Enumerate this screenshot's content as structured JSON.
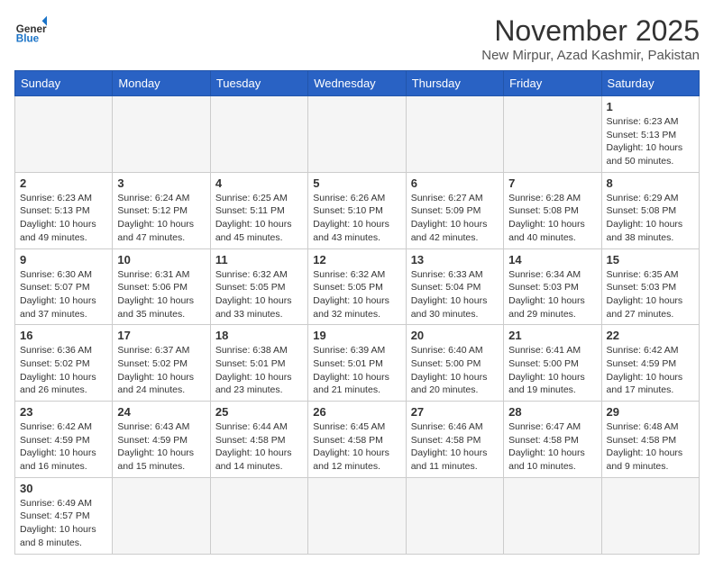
{
  "header": {
    "logo_general": "General",
    "logo_blue": "Blue",
    "title": "November 2025",
    "subtitle": "New Mirpur, Azad Kashmir, Pakistan"
  },
  "days_of_week": [
    "Sunday",
    "Monday",
    "Tuesday",
    "Wednesday",
    "Thursday",
    "Friday",
    "Saturday"
  ],
  "weeks": [
    [
      {
        "day": "",
        "info": ""
      },
      {
        "day": "",
        "info": ""
      },
      {
        "day": "",
        "info": ""
      },
      {
        "day": "",
        "info": ""
      },
      {
        "day": "",
        "info": ""
      },
      {
        "day": "",
        "info": ""
      },
      {
        "day": "1",
        "info": "Sunrise: 6:23 AM\nSunset: 5:13 PM\nDaylight: 10 hours\nand 50 minutes."
      }
    ],
    [
      {
        "day": "2",
        "info": "Sunrise: 6:23 AM\nSunset: 5:13 PM\nDaylight: 10 hours\nand 49 minutes."
      },
      {
        "day": "3",
        "info": "Sunrise: 6:24 AM\nSunset: 5:12 PM\nDaylight: 10 hours\nand 47 minutes."
      },
      {
        "day": "4",
        "info": "Sunrise: 6:25 AM\nSunset: 5:11 PM\nDaylight: 10 hours\nand 45 minutes."
      },
      {
        "day": "5",
        "info": "Sunrise: 6:26 AM\nSunset: 5:10 PM\nDaylight: 10 hours\nand 43 minutes."
      },
      {
        "day": "6",
        "info": "Sunrise: 6:27 AM\nSunset: 5:09 PM\nDaylight: 10 hours\nand 42 minutes."
      },
      {
        "day": "7",
        "info": "Sunrise: 6:28 AM\nSunset: 5:08 PM\nDaylight: 10 hours\nand 40 minutes."
      },
      {
        "day": "8",
        "info": "Sunrise: 6:29 AM\nSunset: 5:08 PM\nDaylight: 10 hours\nand 38 minutes."
      }
    ],
    [
      {
        "day": "9",
        "info": "Sunrise: 6:30 AM\nSunset: 5:07 PM\nDaylight: 10 hours\nand 37 minutes."
      },
      {
        "day": "10",
        "info": "Sunrise: 6:31 AM\nSunset: 5:06 PM\nDaylight: 10 hours\nand 35 minutes."
      },
      {
        "day": "11",
        "info": "Sunrise: 6:32 AM\nSunset: 5:05 PM\nDaylight: 10 hours\nand 33 minutes."
      },
      {
        "day": "12",
        "info": "Sunrise: 6:32 AM\nSunset: 5:05 PM\nDaylight: 10 hours\nand 32 minutes."
      },
      {
        "day": "13",
        "info": "Sunrise: 6:33 AM\nSunset: 5:04 PM\nDaylight: 10 hours\nand 30 minutes."
      },
      {
        "day": "14",
        "info": "Sunrise: 6:34 AM\nSunset: 5:03 PM\nDaylight: 10 hours\nand 29 minutes."
      },
      {
        "day": "15",
        "info": "Sunrise: 6:35 AM\nSunset: 5:03 PM\nDaylight: 10 hours\nand 27 minutes."
      }
    ],
    [
      {
        "day": "16",
        "info": "Sunrise: 6:36 AM\nSunset: 5:02 PM\nDaylight: 10 hours\nand 26 minutes."
      },
      {
        "day": "17",
        "info": "Sunrise: 6:37 AM\nSunset: 5:02 PM\nDaylight: 10 hours\nand 24 minutes."
      },
      {
        "day": "18",
        "info": "Sunrise: 6:38 AM\nSunset: 5:01 PM\nDaylight: 10 hours\nand 23 minutes."
      },
      {
        "day": "19",
        "info": "Sunrise: 6:39 AM\nSunset: 5:01 PM\nDaylight: 10 hours\nand 21 minutes."
      },
      {
        "day": "20",
        "info": "Sunrise: 6:40 AM\nSunset: 5:00 PM\nDaylight: 10 hours\nand 20 minutes."
      },
      {
        "day": "21",
        "info": "Sunrise: 6:41 AM\nSunset: 5:00 PM\nDaylight: 10 hours\nand 19 minutes."
      },
      {
        "day": "22",
        "info": "Sunrise: 6:42 AM\nSunset: 4:59 PM\nDaylight: 10 hours\nand 17 minutes."
      }
    ],
    [
      {
        "day": "23",
        "info": "Sunrise: 6:42 AM\nSunset: 4:59 PM\nDaylight: 10 hours\nand 16 minutes."
      },
      {
        "day": "24",
        "info": "Sunrise: 6:43 AM\nSunset: 4:59 PM\nDaylight: 10 hours\nand 15 minutes."
      },
      {
        "day": "25",
        "info": "Sunrise: 6:44 AM\nSunset: 4:58 PM\nDaylight: 10 hours\nand 14 minutes."
      },
      {
        "day": "26",
        "info": "Sunrise: 6:45 AM\nSunset: 4:58 PM\nDaylight: 10 hours\nand 12 minutes."
      },
      {
        "day": "27",
        "info": "Sunrise: 6:46 AM\nSunset: 4:58 PM\nDaylight: 10 hours\nand 11 minutes."
      },
      {
        "day": "28",
        "info": "Sunrise: 6:47 AM\nSunset: 4:58 PM\nDaylight: 10 hours\nand 10 minutes."
      },
      {
        "day": "29",
        "info": "Sunrise: 6:48 AM\nSunset: 4:58 PM\nDaylight: 10 hours\nand 9 minutes."
      }
    ],
    [
      {
        "day": "30",
        "info": "Sunrise: 6:49 AM\nSunset: 4:57 PM\nDaylight: 10 hours\nand 8 minutes."
      },
      {
        "day": "",
        "info": ""
      },
      {
        "day": "",
        "info": ""
      },
      {
        "day": "",
        "info": ""
      },
      {
        "day": "",
        "info": ""
      },
      {
        "day": "",
        "info": ""
      },
      {
        "day": "",
        "info": ""
      }
    ]
  ]
}
